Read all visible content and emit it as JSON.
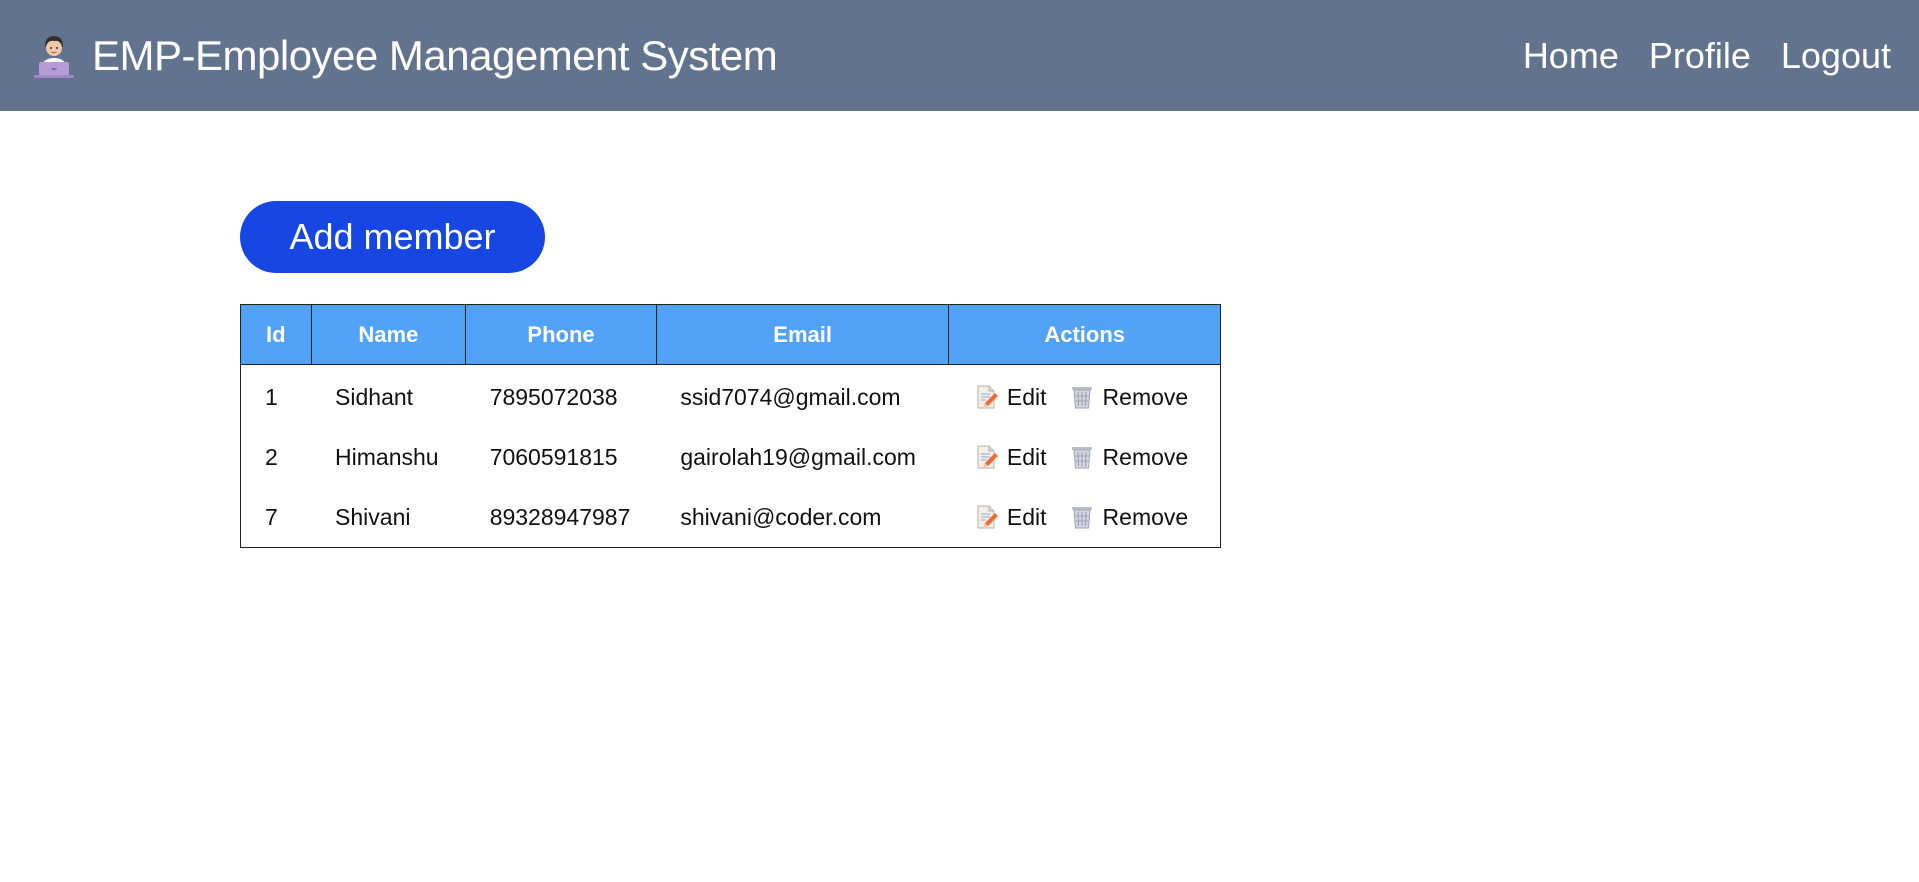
{
  "header": {
    "brand_icon": "technologist-emoji-icon",
    "title": "EMP-Employee Management System",
    "nav": [
      {
        "label": "Home"
      },
      {
        "label": "Profile"
      },
      {
        "label": "Logout"
      }
    ],
    "background_color": "#62738d"
  },
  "main": {
    "add_button_label": "Add member",
    "add_button_color": "#1746e2",
    "table": {
      "header_color": "#52a2f8",
      "columns": [
        "Id",
        "Name",
        "Phone",
        "Email",
        "Actions"
      ],
      "rows": [
        {
          "id": "1",
          "name": "Sidhant",
          "phone": "7895072038",
          "email": "ssid7074@gmail.com"
        },
        {
          "id": "2",
          "name": "Himanshu",
          "phone": "7060591815",
          "email": "gairolah19@gmail.com"
        },
        {
          "id": "7",
          "name": "Shivani",
          "phone": "89328947987",
          "email": "shivani@coder.com"
        }
      ],
      "actions": {
        "edit_label": "Edit",
        "edit_icon": "memo-pencil-icon",
        "remove_label": "Remove",
        "remove_icon": "wastebasket-icon"
      }
    }
  }
}
